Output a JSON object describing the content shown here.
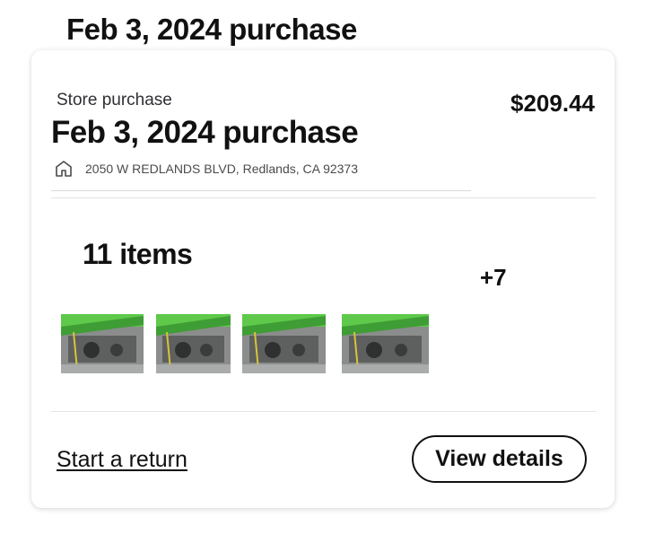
{
  "page": {
    "heading": "Feb 3, 2024 purchase"
  },
  "order": {
    "store_label": "Store purchase",
    "total": "$209.44",
    "title": "Feb 3, 2024 purchase",
    "address": "2050 W REDLANDS BLVD, Redlands, CA 92373",
    "address_icon": "store-icon"
  },
  "items": {
    "count_label": "11 items",
    "more_label": "+7",
    "thumbnails": [
      {
        "name": "product-thumbnail-1",
        "description": "green product package"
      },
      {
        "name": "product-thumbnail-2",
        "description": "green product package"
      },
      {
        "name": "product-thumbnail-3",
        "description": "green product package"
      },
      {
        "name": "product-thumbnail-4",
        "description": "green product package"
      }
    ]
  },
  "actions": {
    "return_label": "Start a return",
    "details_label": "View details"
  },
  "colors": {
    "text": "#111111",
    "muted": "#4a4b4e",
    "product_green": "#5ec94a",
    "product_gray": "#6b6e6c"
  }
}
